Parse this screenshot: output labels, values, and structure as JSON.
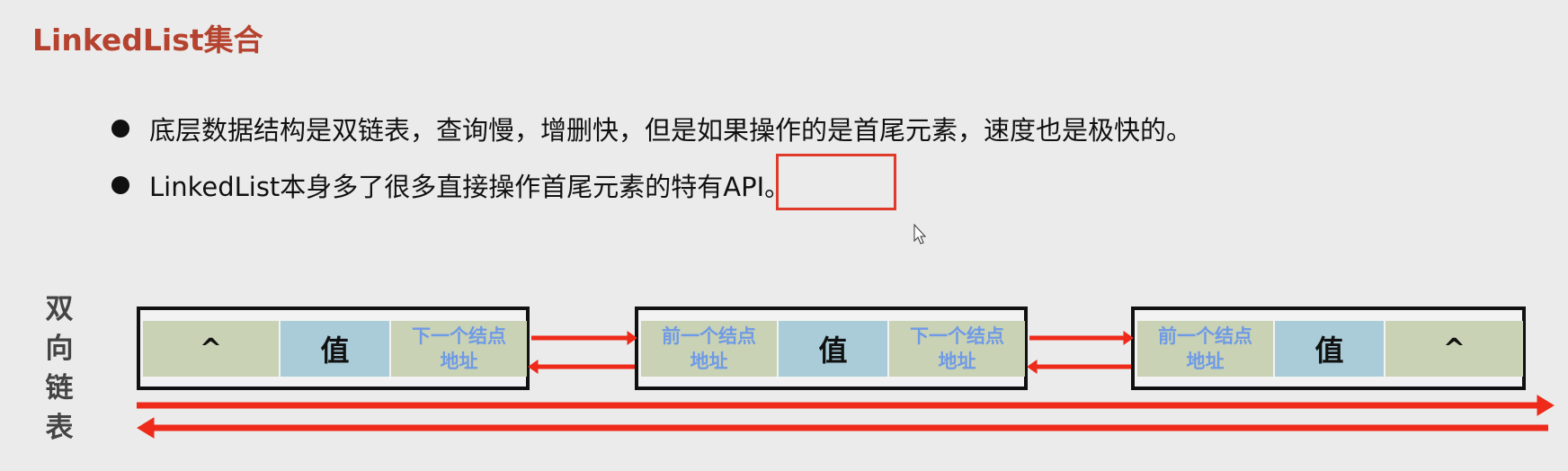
{
  "title": "LinkedList集合",
  "bullets": [
    "底层数据结构是双链表，查询慢，增删快，但是如果操作的是首尾元素，速度也是极快的。",
    "LinkedList本身多了很多直接操作首尾元素的特有API。"
  ],
  "side_label": "双向链表",
  "labels": {
    "null": "^",
    "value": "值",
    "prev": "前一个结点地址",
    "next": "下一个结点地址"
  },
  "colors": {
    "title": "#b5432f",
    "arrow": "#ee2a1a",
    "highlight": "#e03a2a"
  }
}
